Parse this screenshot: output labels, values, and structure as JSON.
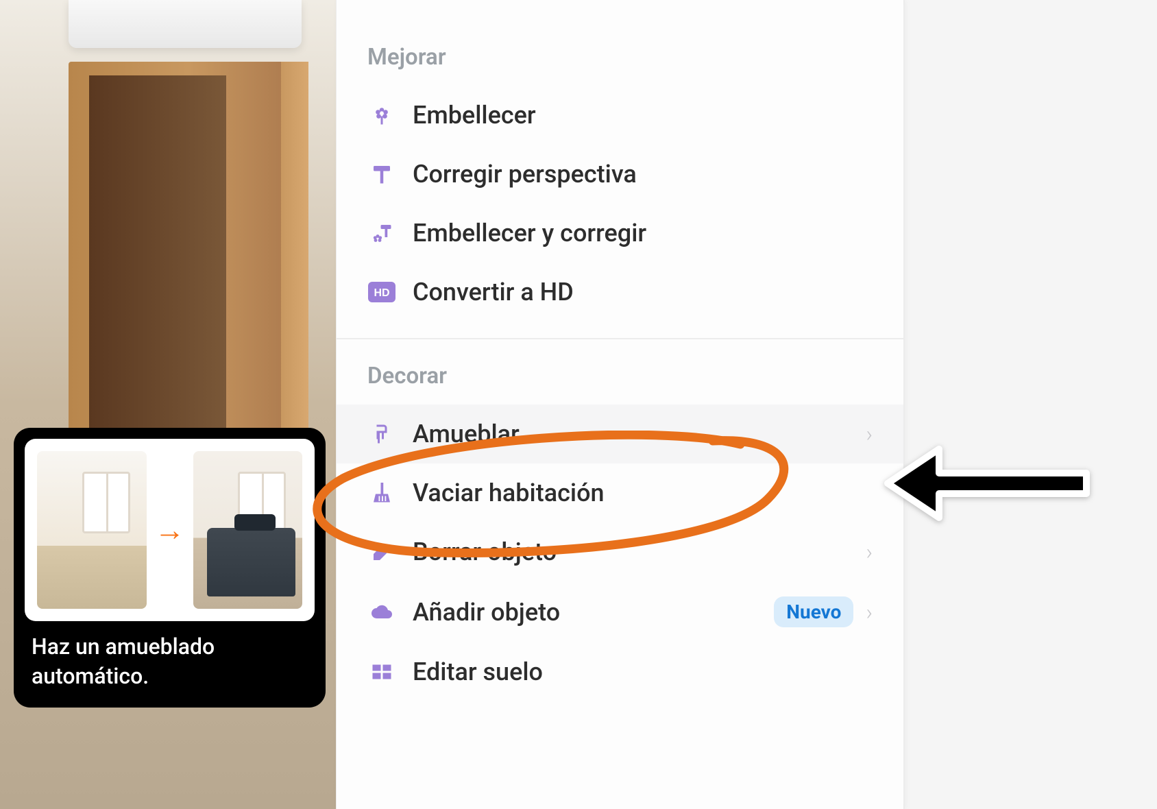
{
  "tooltip": {
    "text": "Haz un amueblado automático."
  },
  "sections": {
    "mejorar": {
      "header": "Mejorar",
      "items": [
        {
          "label": "Embellecer",
          "icon": "flower-icon",
          "chevron": false
        },
        {
          "label": "Corregir perspectiva",
          "icon": "ruler-icon",
          "chevron": false
        },
        {
          "label": "Embellecer y corregir",
          "icon": "flower-ruler-icon",
          "chevron": false
        },
        {
          "label": "Convertir a HD",
          "icon": "hd-icon",
          "chevron": false
        }
      ]
    },
    "decorar": {
      "header": "Decorar",
      "items": [
        {
          "label": "Amueblar",
          "icon": "chair-icon",
          "chevron": true,
          "hovered": true
        },
        {
          "label": "Vaciar habitación",
          "icon": "broom-icon",
          "chevron": false
        },
        {
          "label": "Borrar objeto",
          "icon": "eraser-icon",
          "chevron": true
        },
        {
          "label": "Añadir objeto",
          "icon": "cloud-icon",
          "chevron": true,
          "badge": "Nuevo"
        },
        {
          "label": "Editar suelo",
          "icon": "grid-icon",
          "chevron": false
        }
      ]
    }
  }
}
